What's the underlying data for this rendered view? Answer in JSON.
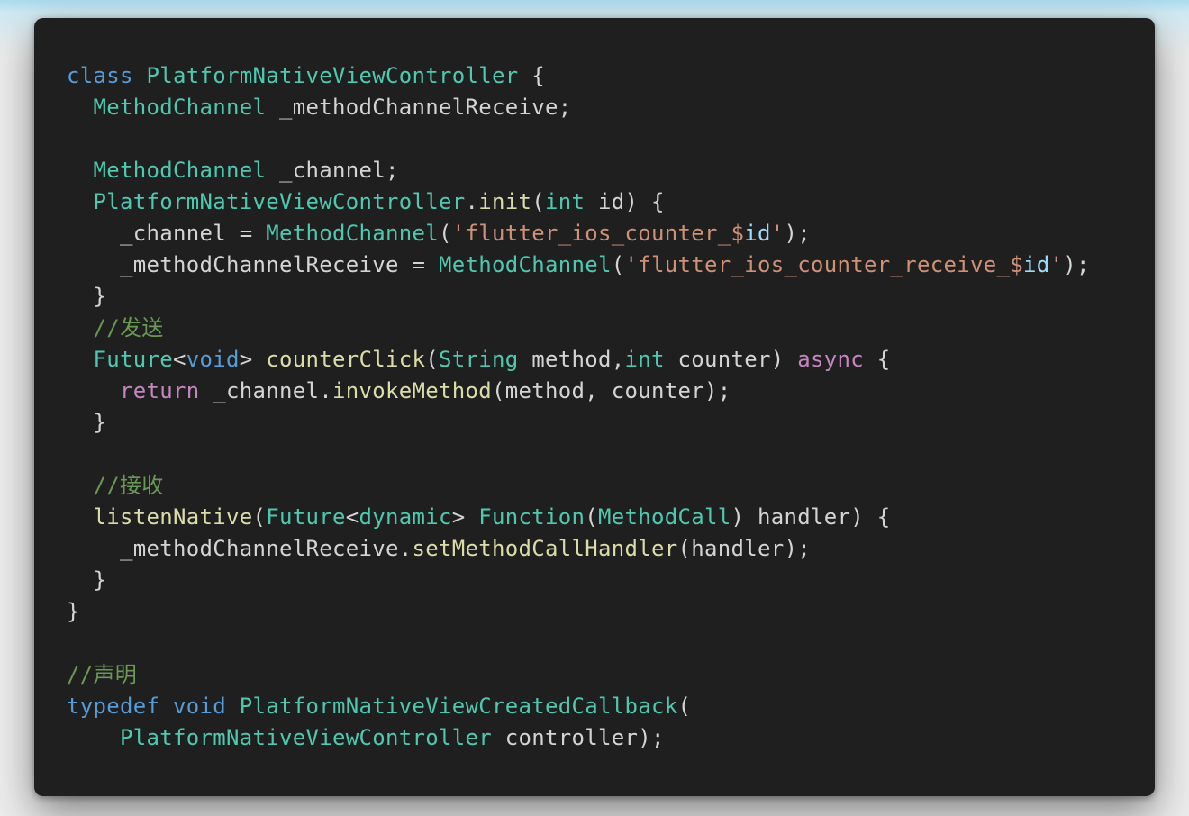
{
  "code_lines": [
    [
      {
        "t": "class",
        "c": "kw"
      },
      {
        "t": " ",
        "c": "pl"
      },
      {
        "t": "PlatformNativeViewController",
        "c": "ty"
      },
      {
        "t": " {",
        "c": "pl"
      }
    ],
    [
      {
        "t": "  ",
        "c": "pl"
      },
      {
        "t": "MethodChannel",
        "c": "ty"
      },
      {
        "t": " _methodChannelReceive;",
        "c": "pl"
      }
    ],
    [],
    [
      {
        "t": "  ",
        "c": "pl"
      },
      {
        "t": "MethodChannel",
        "c": "ty"
      },
      {
        "t": " _channel;",
        "c": "pl"
      }
    ],
    [
      {
        "t": "  ",
        "c": "pl"
      },
      {
        "t": "PlatformNativeViewController",
        "c": "ty"
      },
      {
        "t": ".",
        "c": "pl"
      },
      {
        "t": "init",
        "c": "fn"
      },
      {
        "t": "(",
        "c": "pl"
      },
      {
        "t": "int",
        "c": "ty"
      },
      {
        "t": " id) {",
        "c": "pl"
      }
    ],
    [
      {
        "t": "    _channel = ",
        "c": "pl"
      },
      {
        "t": "MethodChannel",
        "c": "ty"
      },
      {
        "t": "(",
        "c": "pl"
      },
      {
        "t": "'flutter_ios_counter_$",
        "c": "st"
      },
      {
        "t": "id",
        "c": "vr"
      },
      {
        "t": "'",
        "c": "st"
      },
      {
        "t": ");",
        "c": "pl"
      }
    ],
    [
      {
        "t": "    _methodChannelReceive = ",
        "c": "pl"
      },
      {
        "t": "MethodChannel",
        "c": "ty"
      },
      {
        "t": "(",
        "c": "pl"
      },
      {
        "t": "'flutter_ios_counter_receive_$",
        "c": "st"
      },
      {
        "t": "id",
        "c": "vr"
      },
      {
        "t": "'",
        "c": "st"
      },
      {
        "t": ");",
        "c": "pl"
      }
    ],
    [
      {
        "t": "  }",
        "c": "pl"
      }
    ],
    [
      {
        "t": "  ",
        "c": "pl"
      },
      {
        "t": "//发送",
        "c": "cm"
      }
    ],
    [
      {
        "t": "  ",
        "c": "pl"
      },
      {
        "t": "Future",
        "c": "ty"
      },
      {
        "t": "<",
        "c": "pl"
      },
      {
        "t": "void",
        "c": "kw"
      },
      {
        "t": "> ",
        "c": "pl"
      },
      {
        "t": "counterClick",
        "c": "fn"
      },
      {
        "t": "(",
        "c": "pl"
      },
      {
        "t": "String",
        "c": "ty"
      },
      {
        "t": " method,",
        "c": "pl"
      },
      {
        "t": "int",
        "c": "ty"
      },
      {
        "t": " counter) ",
        "c": "pl"
      },
      {
        "t": "async",
        "c": "kw2"
      },
      {
        "t": " {",
        "c": "pl"
      }
    ],
    [
      {
        "t": "    ",
        "c": "pl"
      },
      {
        "t": "return",
        "c": "kw2"
      },
      {
        "t": " _channel.",
        "c": "pl"
      },
      {
        "t": "invokeMethod",
        "c": "fn"
      },
      {
        "t": "(method, counter);",
        "c": "pl"
      }
    ],
    [
      {
        "t": "  }",
        "c": "pl"
      }
    ],
    [],
    [
      {
        "t": "  ",
        "c": "pl"
      },
      {
        "t": "//接收",
        "c": "cm"
      }
    ],
    [
      {
        "t": "  ",
        "c": "pl"
      },
      {
        "t": "listenNative",
        "c": "fn"
      },
      {
        "t": "(",
        "c": "pl"
      },
      {
        "t": "Future",
        "c": "ty"
      },
      {
        "t": "<",
        "c": "pl"
      },
      {
        "t": "dynamic",
        "c": "ty"
      },
      {
        "t": "> ",
        "c": "pl"
      },
      {
        "t": "Function",
        "c": "ty"
      },
      {
        "t": "(",
        "c": "pl"
      },
      {
        "t": "MethodCall",
        "c": "ty"
      },
      {
        "t": ") handler) {",
        "c": "pl"
      }
    ],
    [
      {
        "t": "    _methodChannelReceive.",
        "c": "pl"
      },
      {
        "t": "setMethodCallHandler",
        "c": "fn"
      },
      {
        "t": "(handler);",
        "c": "pl"
      }
    ],
    [
      {
        "t": "  }",
        "c": "pl"
      }
    ],
    [
      {
        "t": "}",
        "c": "pl"
      }
    ],
    [],
    [
      {
        "t": "//声明",
        "c": "cm"
      }
    ],
    [
      {
        "t": "typedef",
        "c": "kw"
      },
      {
        "t": " ",
        "c": "pl"
      },
      {
        "t": "void",
        "c": "kw"
      },
      {
        "t": " ",
        "c": "pl"
      },
      {
        "t": "PlatformNativeViewCreatedCallback",
        "c": "ty"
      },
      {
        "t": "(",
        "c": "pl"
      }
    ],
    [
      {
        "t": "    ",
        "c": "pl"
      },
      {
        "t": "PlatformNativeViewController",
        "c": "ty"
      },
      {
        "t": " controller);",
        "c": "pl"
      }
    ]
  ],
  "colors": {
    "background": "#1f1f1f",
    "keyword": "#569cd6",
    "control_keyword": "#c586c0",
    "type": "#4ec9b0",
    "function": "#dcdcaa",
    "string": "#ce9178",
    "variable": "#9cdcfe",
    "comment": "#6a9955",
    "plain": "#d4d4d4"
  }
}
